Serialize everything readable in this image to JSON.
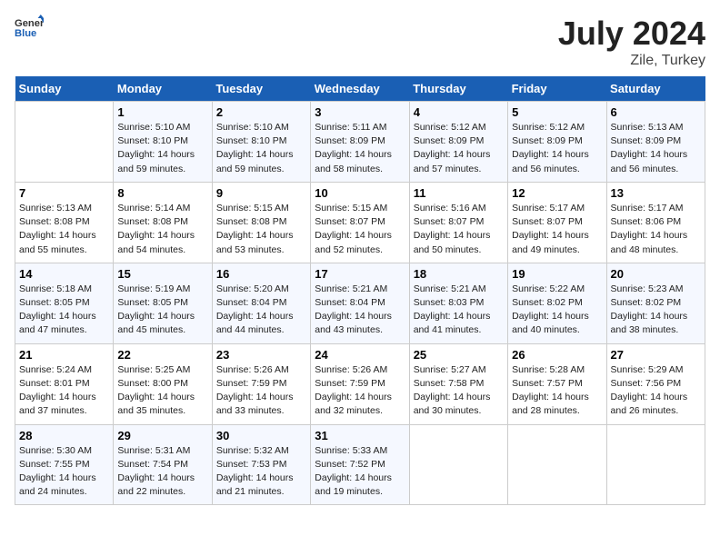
{
  "header": {
    "logo_general": "General",
    "logo_blue": "Blue",
    "month_year": "July 2024",
    "location": "Zile, Turkey"
  },
  "days_of_week": [
    "Sunday",
    "Monday",
    "Tuesday",
    "Wednesday",
    "Thursday",
    "Friday",
    "Saturday"
  ],
  "weeks": [
    [
      {
        "day": "",
        "info": ""
      },
      {
        "day": "1",
        "info": "Sunrise: 5:10 AM\nSunset: 8:10 PM\nDaylight: 14 hours\nand 59 minutes."
      },
      {
        "day": "2",
        "info": "Sunrise: 5:10 AM\nSunset: 8:10 PM\nDaylight: 14 hours\nand 59 minutes."
      },
      {
        "day": "3",
        "info": "Sunrise: 5:11 AM\nSunset: 8:09 PM\nDaylight: 14 hours\nand 58 minutes."
      },
      {
        "day": "4",
        "info": "Sunrise: 5:12 AM\nSunset: 8:09 PM\nDaylight: 14 hours\nand 57 minutes."
      },
      {
        "day": "5",
        "info": "Sunrise: 5:12 AM\nSunset: 8:09 PM\nDaylight: 14 hours\nand 56 minutes."
      },
      {
        "day": "6",
        "info": "Sunrise: 5:13 AM\nSunset: 8:09 PM\nDaylight: 14 hours\nand 56 minutes."
      }
    ],
    [
      {
        "day": "7",
        "info": "Sunrise: 5:13 AM\nSunset: 8:08 PM\nDaylight: 14 hours\nand 55 minutes."
      },
      {
        "day": "8",
        "info": "Sunrise: 5:14 AM\nSunset: 8:08 PM\nDaylight: 14 hours\nand 54 minutes."
      },
      {
        "day": "9",
        "info": "Sunrise: 5:15 AM\nSunset: 8:08 PM\nDaylight: 14 hours\nand 53 minutes."
      },
      {
        "day": "10",
        "info": "Sunrise: 5:15 AM\nSunset: 8:07 PM\nDaylight: 14 hours\nand 52 minutes."
      },
      {
        "day": "11",
        "info": "Sunrise: 5:16 AM\nSunset: 8:07 PM\nDaylight: 14 hours\nand 50 minutes."
      },
      {
        "day": "12",
        "info": "Sunrise: 5:17 AM\nSunset: 8:07 PM\nDaylight: 14 hours\nand 49 minutes."
      },
      {
        "day": "13",
        "info": "Sunrise: 5:17 AM\nSunset: 8:06 PM\nDaylight: 14 hours\nand 48 minutes."
      }
    ],
    [
      {
        "day": "14",
        "info": "Sunrise: 5:18 AM\nSunset: 8:05 PM\nDaylight: 14 hours\nand 47 minutes."
      },
      {
        "day": "15",
        "info": "Sunrise: 5:19 AM\nSunset: 8:05 PM\nDaylight: 14 hours\nand 45 minutes."
      },
      {
        "day": "16",
        "info": "Sunrise: 5:20 AM\nSunset: 8:04 PM\nDaylight: 14 hours\nand 44 minutes."
      },
      {
        "day": "17",
        "info": "Sunrise: 5:21 AM\nSunset: 8:04 PM\nDaylight: 14 hours\nand 43 minutes."
      },
      {
        "day": "18",
        "info": "Sunrise: 5:21 AM\nSunset: 8:03 PM\nDaylight: 14 hours\nand 41 minutes."
      },
      {
        "day": "19",
        "info": "Sunrise: 5:22 AM\nSunset: 8:02 PM\nDaylight: 14 hours\nand 40 minutes."
      },
      {
        "day": "20",
        "info": "Sunrise: 5:23 AM\nSunset: 8:02 PM\nDaylight: 14 hours\nand 38 minutes."
      }
    ],
    [
      {
        "day": "21",
        "info": "Sunrise: 5:24 AM\nSunset: 8:01 PM\nDaylight: 14 hours\nand 37 minutes."
      },
      {
        "day": "22",
        "info": "Sunrise: 5:25 AM\nSunset: 8:00 PM\nDaylight: 14 hours\nand 35 minutes."
      },
      {
        "day": "23",
        "info": "Sunrise: 5:26 AM\nSunset: 7:59 PM\nDaylight: 14 hours\nand 33 minutes."
      },
      {
        "day": "24",
        "info": "Sunrise: 5:26 AM\nSunset: 7:59 PM\nDaylight: 14 hours\nand 32 minutes."
      },
      {
        "day": "25",
        "info": "Sunrise: 5:27 AM\nSunset: 7:58 PM\nDaylight: 14 hours\nand 30 minutes."
      },
      {
        "day": "26",
        "info": "Sunrise: 5:28 AM\nSunset: 7:57 PM\nDaylight: 14 hours\nand 28 minutes."
      },
      {
        "day": "27",
        "info": "Sunrise: 5:29 AM\nSunset: 7:56 PM\nDaylight: 14 hours\nand 26 minutes."
      }
    ],
    [
      {
        "day": "28",
        "info": "Sunrise: 5:30 AM\nSunset: 7:55 PM\nDaylight: 14 hours\nand 24 minutes."
      },
      {
        "day": "29",
        "info": "Sunrise: 5:31 AM\nSunset: 7:54 PM\nDaylight: 14 hours\nand 22 minutes."
      },
      {
        "day": "30",
        "info": "Sunrise: 5:32 AM\nSunset: 7:53 PM\nDaylight: 14 hours\nand 21 minutes."
      },
      {
        "day": "31",
        "info": "Sunrise: 5:33 AM\nSunset: 7:52 PM\nDaylight: 14 hours\nand 19 minutes."
      },
      {
        "day": "",
        "info": ""
      },
      {
        "day": "",
        "info": ""
      },
      {
        "day": "",
        "info": ""
      }
    ]
  ]
}
